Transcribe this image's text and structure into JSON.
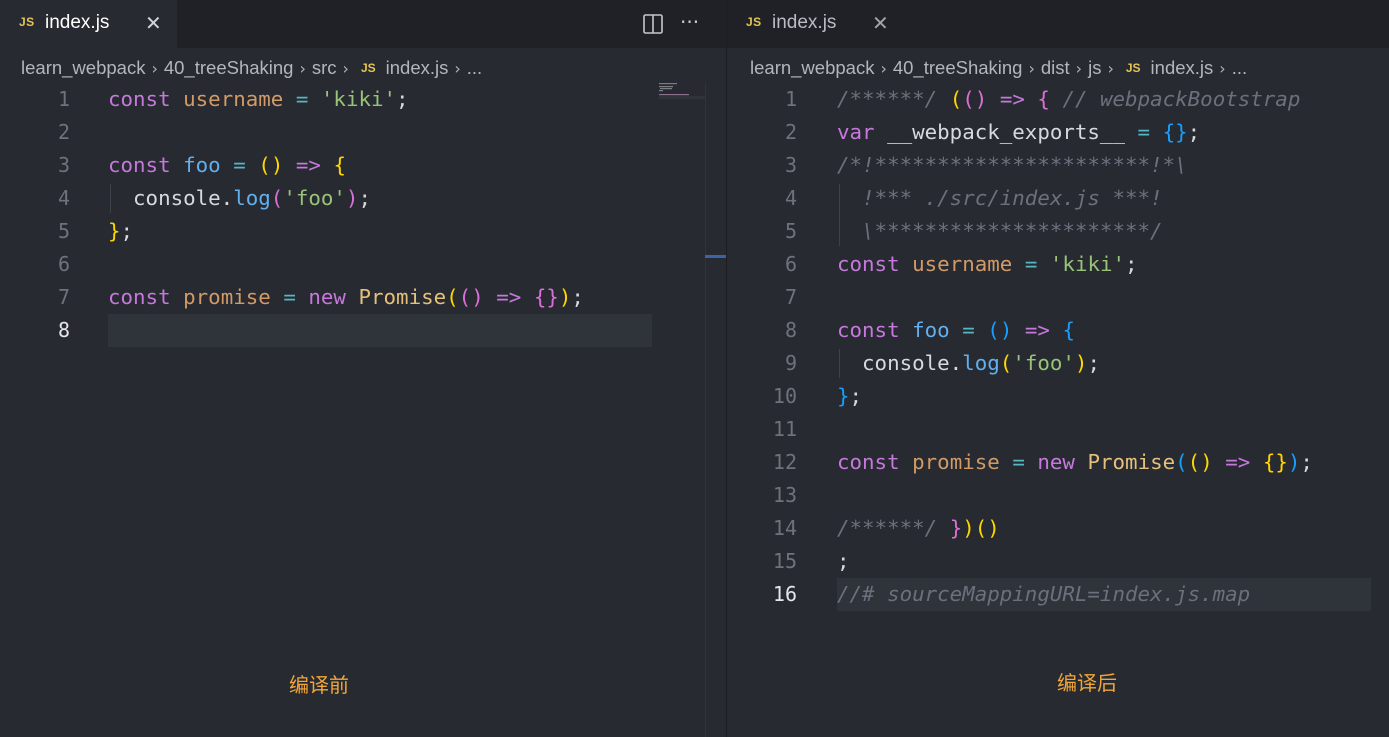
{
  "left_pane": {
    "tab": {
      "badge": "JS",
      "title": "index.js",
      "close": "✕"
    },
    "actions": {
      "more": "···"
    },
    "breadcrumb": [
      "learn_webpack",
      "40_treeShaking",
      "src"
    ],
    "breadcrumb_file_badge": "JS",
    "breadcrumb_file": "index.js",
    "breadcrumb_tail": "...",
    "active_line": 8,
    "lines": [
      [
        [
          "kw",
          "const"
        ],
        [
          "pl",
          " "
        ],
        [
          "vr",
          "username"
        ],
        [
          "pl",
          " "
        ],
        [
          "op",
          "="
        ],
        [
          "pl",
          " "
        ],
        [
          "st",
          "'kiki'"
        ],
        [
          "pl",
          ";"
        ]
      ],
      [],
      [
        [
          "kw",
          "const"
        ],
        [
          "pl",
          " "
        ],
        [
          "fn",
          "foo"
        ],
        [
          "pl",
          " "
        ],
        [
          "op",
          "="
        ],
        [
          "pl",
          " "
        ],
        [
          "p1",
          "()"
        ],
        [
          "pl",
          " "
        ],
        [
          "kw",
          "=>"
        ],
        [
          "pl",
          " "
        ],
        [
          "p1",
          "{"
        ]
      ],
      [
        [
          "pl",
          "  console."
        ],
        [
          "fn",
          "log"
        ],
        [
          "p2",
          "("
        ],
        [
          "st",
          "'foo'"
        ],
        [
          "p2",
          ")"
        ],
        [
          "pl",
          ";"
        ]
      ],
      [
        [
          "p1",
          "}"
        ],
        [
          "pl",
          ";"
        ]
      ],
      [],
      [
        [
          "kw",
          "const"
        ],
        [
          "pl",
          " "
        ],
        [
          "vr",
          "promise"
        ],
        [
          "pl",
          " "
        ],
        [
          "op",
          "="
        ],
        [
          "pl",
          " "
        ],
        [
          "kw",
          "new"
        ],
        [
          "pl",
          " "
        ],
        [
          "cls",
          "Promise"
        ],
        [
          "p1",
          "("
        ],
        [
          "p2",
          "()"
        ],
        [
          "pl",
          " "
        ],
        [
          "kw",
          "=>"
        ],
        [
          "pl",
          " "
        ],
        [
          "p2",
          "{}"
        ],
        [
          "p1",
          ")"
        ],
        [
          "pl",
          ";"
        ]
      ],
      []
    ],
    "caption": "编译前"
  },
  "right_pane": {
    "tab": {
      "badge": "JS",
      "title": "index.js",
      "close": "✕"
    },
    "breadcrumb": [
      "learn_webpack",
      "40_treeShaking",
      "dist",
      "js"
    ],
    "breadcrumb_file_badge": "JS",
    "breadcrumb_file": "index.js",
    "breadcrumb_tail": "...",
    "active_line": 16,
    "lines": [
      [
        [
          "cm",
          "/******/"
        ],
        [
          "pl",
          " "
        ],
        [
          "p1",
          "("
        ],
        [
          "p2",
          "()"
        ],
        [
          "pl",
          " "
        ],
        [
          "kw",
          "=>"
        ],
        [
          "pl",
          " "
        ],
        [
          "p2",
          "{"
        ],
        [
          "pl",
          " "
        ],
        [
          "cm",
          "// webpackBootstrap"
        ]
      ],
      [
        [
          "kw",
          "var"
        ],
        [
          "pl",
          " __webpack_exports__ "
        ],
        [
          "op",
          "="
        ],
        [
          "pl",
          " "
        ],
        [
          "p3",
          "{}"
        ],
        [
          "pl",
          ";"
        ]
      ],
      [
        [
          "cm",
          "/*!**********************!*\\"
        ]
      ],
      [
        [
          "cm",
          "  !*** ./src/index.js ***!"
        ]
      ],
      [
        [
          "cm",
          "  \\**********************/"
        ]
      ],
      [
        [
          "kw",
          "const"
        ],
        [
          "pl",
          " "
        ],
        [
          "vr",
          "username"
        ],
        [
          "pl",
          " "
        ],
        [
          "op",
          "="
        ],
        [
          "pl",
          " "
        ],
        [
          "st",
          "'kiki'"
        ],
        [
          "pl",
          ";"
        ]
      ],
      [],
      [
        [
          "kw",
          "const"
        ],
        [
          "pl",
          " "
        ],
        [
          "fn",
          "foo"
        ],
        [
          "pl",
          " "
        ],
        [
          "op",
          "="
        ],
        [
          "pl",
          " "
        ],
        [
          "p3",
          "()"
        ],
        [
          "pl",
          " "
        ],
        [
          "kw",
          "=>"
        ],
        [
          "pl",
          " "
        ],
        [
          "p3",
          "{"
        ]
      ],
      [
        [
          "pl",
          "  console."
        ],
        [
          "fn",
          "log"
        ],
        [
          "p1",
          "("
        ],
        [
          "st",
          "'foo'"
        ],
        [
          "p1",
          ")"
        ],
        [
          "pl",
          ";"
        ]
      ],
      [
        [
          "p3",
          "}"
        ],
        [
          "pl",
          ";"
        ]
      ],
      [],
      [
        [
          "kw",
          "const"
        ],
        [
          "pl",
          " "
        ],
        [
          "vr",
          "promise"
        ],
        [
          "pl",
          " "
        ],
        [
          "op",
          "="
        ],
        [
          "pl",
          " "
        ],
        [
          "kw",
          "new"
        ],
        [
          "pl",
          " "
        ],
        [
          "cls",
          "Promise"
        ],
        [
          "p3",
          "("
        ],
        [
          "p1",
          "()"
        ],
        [
          "pl",
          " "
        ],
        [
          "kw",
          "=>"
        ],
        [
          "pl",
          " "
        ],
        [
          "p1",
          "{}"
        ],
        [
          "p3",
          ")"
        ],
        [
          "pl",
          ";"
        ]
      ],
      [],
      [
        [
          "cm",
          "/******/"
        ],
        [
          "pl",
          " "
        ],
        [
          "p2",
          "}"
        ],
        [
          "p1",
          ")"
        ],
        [
          "p1",
          "()"
        ]
      ],
      [
        [
          "pl",
          ";"
        ]
      ],
      [
        [
          "cm",
          "//# sourceMappingURL=index.js.map"
        ]
      ]
    ],
    "caption": "编译后"
  },
  "colors": {
    "background": "#272a30",
    "tab_bar": "#1f2126",
    "caption": "#f2a53a",
    "js_badge": "#e5c550",
    "keyword": "#c678dd",
    "variable": "#d19a66",
    "string": "#98c379",
    "function": "#61afef",
    "comment": "#6b717c"
  },
  "icons": {
    "split": "split-editor-icon",
    "more": "more-actions-icon",
    "close": "close-icon",
    "chevron": "chevron-right-icon"
  }
}
